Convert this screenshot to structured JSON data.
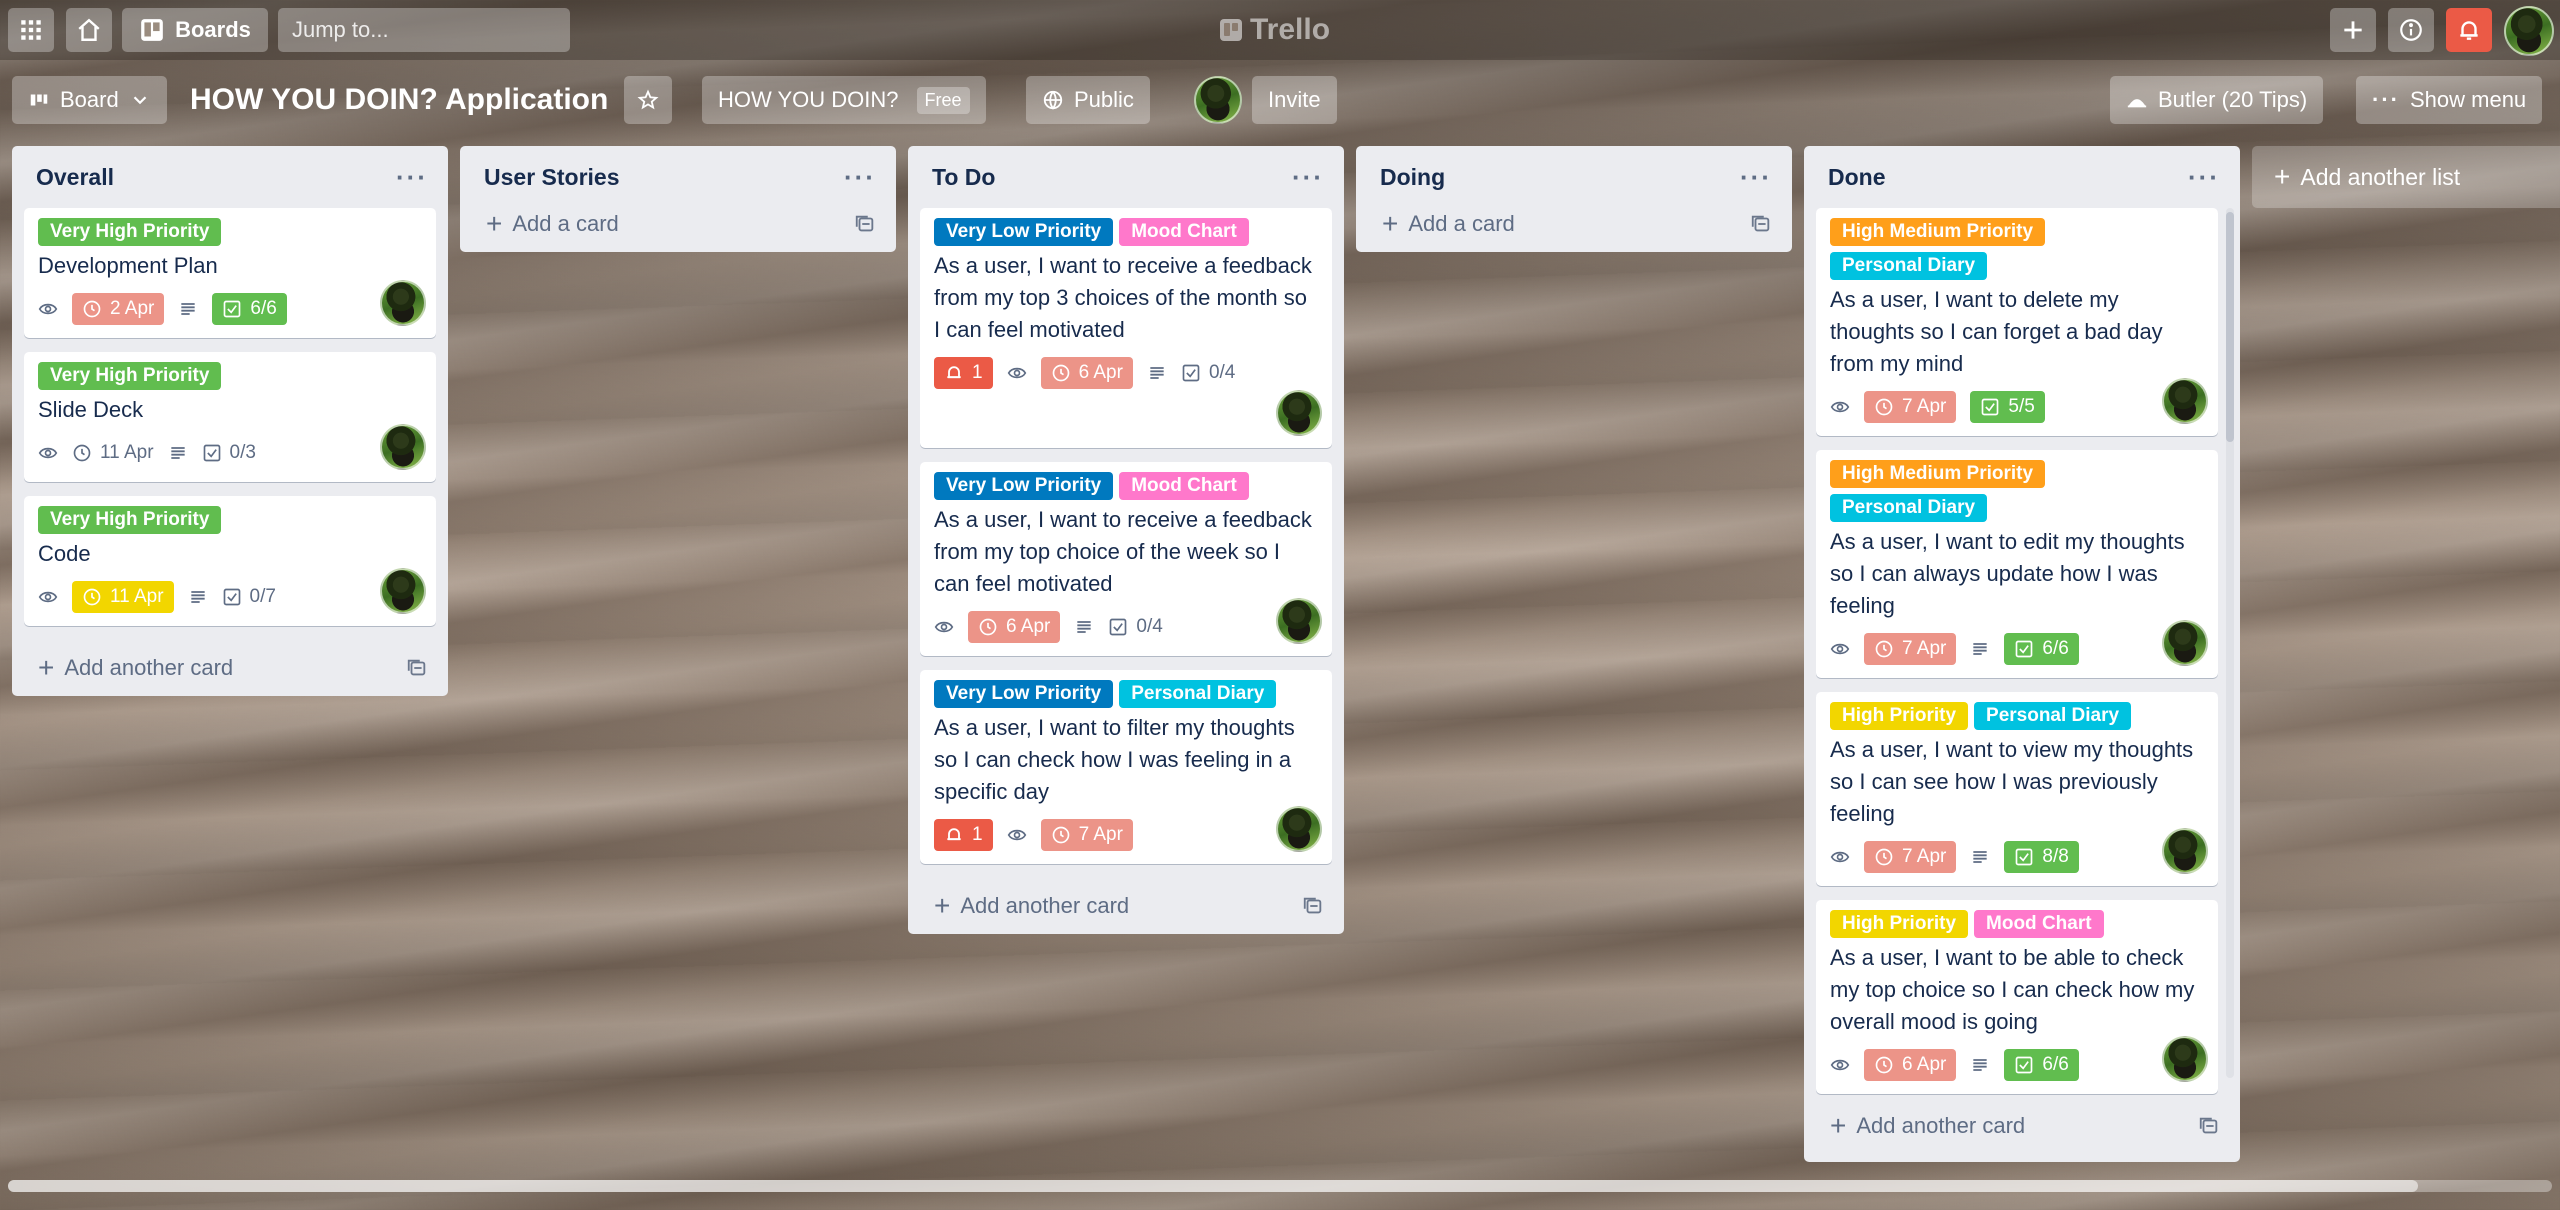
{
  "header": {
    "boards_label": "Boards",
    "search_placeholder": "Jump to...",
    "logo_text": "Trello"
  },
  "board": {
    "view_label": "Board",
    "title": "HOW YOU DOIN? Application",
    "workspace": "HOW YOU DOIN?",
    "workspace_plan": "Free",
    "visibility": "Public",
    "invite_label": "Invite",
    "butler_label": "Butler (20 Tips)",
    "menu_label": "Show menu",
    "add_list_label": "Add another list"
  },
  "colors": {
    "green": "#61bd4f",
    "blue": "#0079bf",
    "pink": "#ff78cb",
    "sky": "#00c2e0",
    "orange": "#ff9f1a",
    "yellow": "#f2d600",
    "red": "#eb5a46",
    "due_red": "#ec9488"
  },
  "lists": {
    "overall": {
      "name": "Overall",
      "add_label": "Add another card",
      "cards": [
        {
          "labels": [
            "Very High Priority"
          ],
          "title": "Development Plan",
          "due": "2 Apr",
          "checklist": "6/6"
        },
        {
          "labels": [
            "Very High Priority"
          ],
          "title": "Slide Deck",
          "due": "11 Apr",
          "checklist": "0/3"
        },
        {
          "labels": [
            "Very High Priority"
          ],
          "title": "Code",
          "due": "11 Apr",
          "checklist": "0/7"
        }
      ]
    },
    "user_stories": {
      "name": "User Stories",
      "add_label": "Add a card"
    },
    "todo": {
      "name": "To Do",
      "add_label": "Add another card",
      "cards": [
        {
          "labels": [
            "Very Low Priority",
            "Mood Chart"
          ],
          "title": "As a user, I want to receive a feedback from my top 3 choices of the month so I can feel motivated",
          "notifications": "1",
          "due": "6 Apr",
          "checklist": "0/4"
        },
        {
          "labels": [
            "Very Low Priority",
            "Mood Chart"
          ],
          "title": "As a user, I want to receive a feedback from my top choice of the week so I can feel motivated",
          "due": "6 Apr",
          "checklist": "0/4"
        },
        {
          "labels": [
            "Very Low Priority",
            "Personal Diary"
          ],
          "title": "As a user, I want to filter my thoughts so I can check how I was feeling in a specific day",
          "notifications": "1",
          "due": "7 Apr"
        }
      ]
    },
    "doing": {
      "name": "Doing",
      "add_label": "Add a card"
    },
    "done": {
      "name": "Done",
      "add_label": "Add another card",
      "cards": [
        {
          "labels": [
            "High Medium Priority",
            "Personal Diary"
          ],
          "title": "As a user, I want to delete my thoughts so I can forget a bad day from my mind",
          "due": "7 Apr",
          "checklist": "5/5"
        },
        {
          "labels": [
            "High Medium Priority",
            "Personal Diary"
          ],
          "title": "As a user, I want to edit my thoughts so I can always update how I was feeling",
          "due": "7 Apr",
          "checklist": "6/6"
        },
        {
          "labels": [
            "High Priority",
            "Personal Diary"
          ],
          "title": "As a user, I want to view my thoughts so I can see how I was previously feeling",
          "due": "7 Apr",
          "checklist": "8/8"
        },
        {
          "labels": [
            "High Priority",
            "Mood Chart"
          ],
          "title": "As a user, I want to be able to check my top choice so I can check how my overall mood is going",
          "due": "6 Apr",
          "checklist": "6/6"
        }
      ]
    }
  }
}
